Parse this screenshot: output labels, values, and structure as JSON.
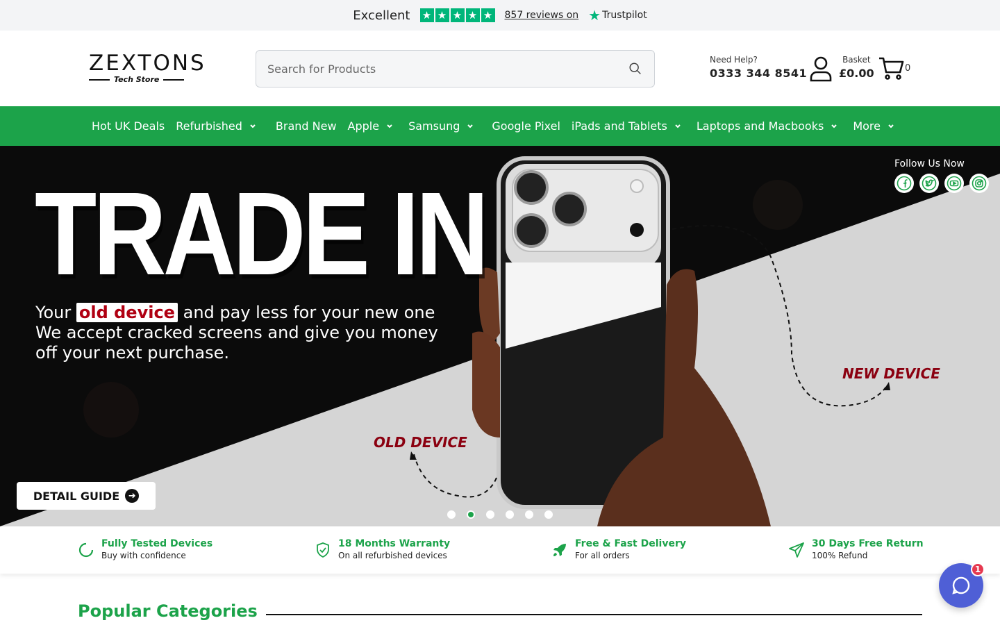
{
  "trustbar": {
    "rating_word": "Excellent",
    "stars": 5,
    "reviews_text": "857 reviews on",
    "brand": "Trustpilot",
    "accent": "#00b67a"
  },
  "header": {
    "logo_wordmark": "ZEXTONS",
    "logo_tagline": "Tech Store",
    "search_placeholder": "Search for Products",
    "help_label": "Need Help?",
    "phone": "0333 344 8541",
    "basket_label": "Basket",
    "basket_total": "£0.00",
    "cart_count": "0"
  },
  "nav": {
    "color": "#1ca34a",
    "items": [
      {
        "label": "Hot UK Deals",
        "dropdown": false
      },
      {
        "label": "Refurbished",
        "dropdown": true
      },
      {
        "label": "Brand New",
        "dropdown": false
      },
      {
        "label": "Apple",
        "dropdown": true
      },
      {
        "label": "Samsung",
        "dropdown": true
      },
      {
        "label": "Google Pixel",
        "dropdown": false
      },
      {
        "label": "iPads and Tablets",
        "dropdown": true
      },
      {
        "label": "Laptops and Macbooks",
        "dropdown": true
      },
      {
        "label": "More",
        "dropdown": true
      }
    ]
  },
  "hero": {
    "title": "TRADE IN",
    "line1_pre": "Your",
    "line1_highlight": "old device",
    "line1_post": "and pay less for your new one",
    "line2": "We accept cracked screens and give you money",
    "line3": "off your next purchase.",
    "old_label": "OLD DEVICE",
    "new_label": "NEW DEVICE",
    "follow_label": "Follow Us Now",
    "socials": [
      "facebook-icon",
      "twitter-icon",
      "youtube-icon",
      "instagram-icon"
    ],
    "cta_label": "DETAIL GUIDE",
    "slides": 6,
    "active_slide": 2
  },
  "features": [
    {
      "title": "Fully Tested Devices",
      "subtitle": "Buy with confidence",
      "icon": "spinner-icon"
    },
    {
      "title": "18 Months Warranty",
      "subtitle": "On all refurbished devices",
      "icon": "shield-check-icon"
    },
    {
      "title": "Free & Fast Delivery",
      "subtitle": "For all orders",
      "icon": "rocket-icon"
    },
    {
      "title": "30 Days Free Return",
      "subtitle": "100% Refund",
      "icon": "paper-plane-icon"
    }
  ],
  "section": {
    "popular_title": "Popular Categories"
  },
  "chat": {
    "badge": "1",
    "color": "#4f5fd6"
  }
}
